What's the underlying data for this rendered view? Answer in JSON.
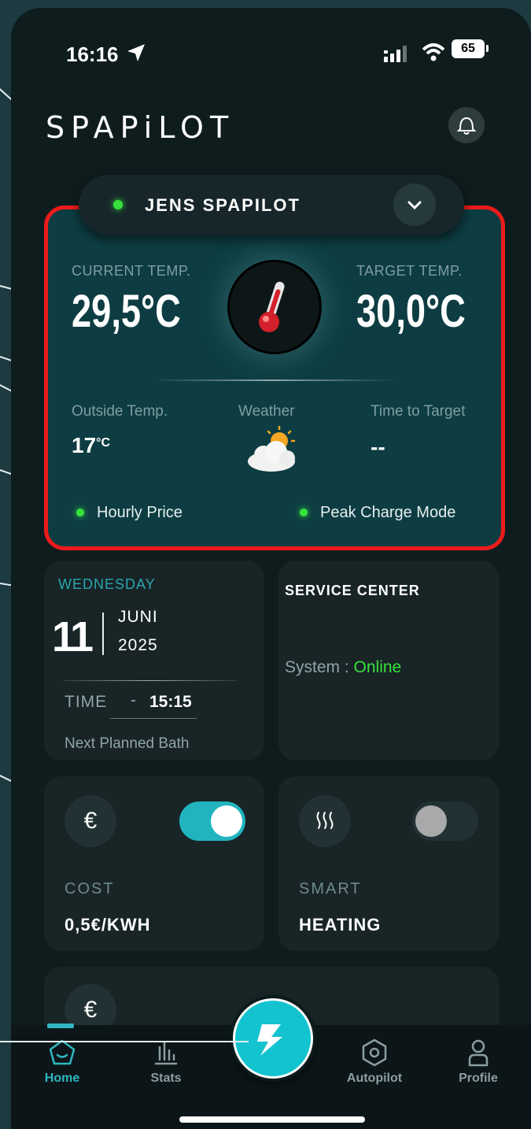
{
  "status_bar": {
    "time": "16:16",
    "battery": "65"
  },
  "app": {
    "logo": "SPAPiLOT"
  },
  "device": {
    "name": "JENS SPAPILOT"
  },
  "temperature": {
    "current_label": "CURRENT TEMP.",
    "current_value": "29,5°C",
    "target_label": "TARGET TEMP.",
    "target_value": "30,0°C",
    "outside_label": "Outside Temp.",
    "outside_value": "17",
    "outside_unit": "°C",
    "weather_label": "Weather",
    "time_to_target_label": "Time to Target",
    "time_to_target_value": "--",
    "hourly_price_label": "Hourly Price",
    "peak_charge_label": "Peak Charge Mode"
  },
  "schedule": {
    "weekday": "WEDNESDAY",
    "day": "11",
    "month": "JUNI",
    "year": "2025",
    "time_label": "TIME",
    "time_sep": "-",
    "time_value": "15:15",
    "caption": "Next Planned Bath"
  },
  "service": {
    "title": "SERVICE CENTER",
    "system_label": "System :",
    "system_status": "Online"
  },
  "cost": {
    "icon": "euro-icon",
    "currency_symbol": "€",
    "label": "COST",
    "value": "0,5€/KWH",
    "toggle_on": true
  },
  "smart_heating": {
    "icon": "heat-waves-icon",
    "symbol": "≀≀≀",
    "label": "SMART",
    "value": "HEATING",
    "toggle_on": false
  },
  "partial_tile": {
    "icon": "euro-icon",
    "currency_symbol": "€"
  },
  "nav": {
    "home": "Home",
    "stats": "Stats",
    "autopilot": "Autopilot",
    "profile": "Profile"
  },
  "colors": {
    "accent": "#13c3cf",
    "online": "#37e13b",
    "alert_border": "#ec1b1b",
    "card_bg": "#0d3d42"
  }
}
